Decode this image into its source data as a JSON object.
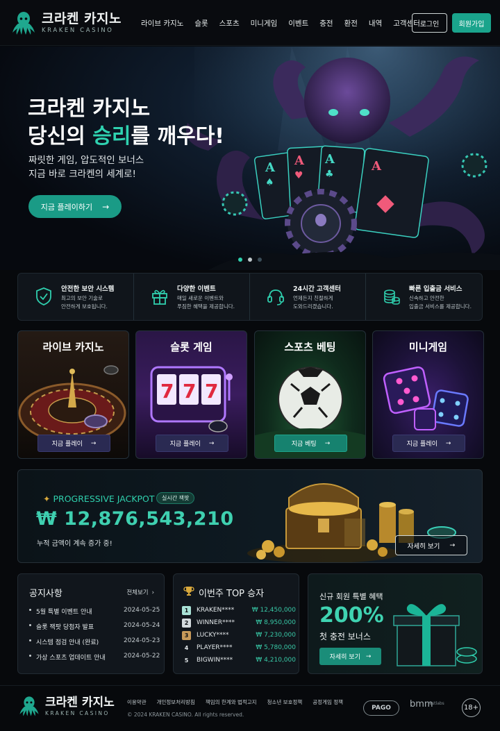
{
  "brand": {
    "name_ko": "크라켄 카지노",
    "name_en": "KRAKEN CASINO"
  },
  "nav": {
    "items": [
      "라이브 카지노",
      "슬롯",
      "스포츠",
      "미니게임",
      "이벤트",
      "충전",
      "환전",
      "내역",
      "고객센터"
    ],
    "login": "로그인",
    "join": "회원가입"
  },
  "hero": {
    "line1": "크라켄 카지노",
    "line2_pre": "당신의 ",
    "line2_accent": "승리",
    "line2_post": "를 깨우다!",
    "sub1": "짜릿한 게임, 압도적인 보너스",
    "sub2": "지금 바로 크라켄의 세계로!",
    "cta": "지금 플레이하기"
  },
  "features": [
    {
      "icon": "shield-check-icon",
      "title": "안전한 보안 시스템",
      "desc": "최고의 보안 기술로\n안전하게 보호됩니다."
    },
    {
      "icon": "gift-icon",
      "title": "다양한 이벤트",
      "desc": "매일 새로운 이벤트와\n푸짐한 혜택을 제공합니다."
    },
    {
      "icon": "headset-icon",
      "title": "24시간 고객센터",
      "desc": "언제든지 친절하게\n도와드리겠습니다."
    },
    {
      "icon": "coins-icon",
      "title": "빠른 입출금 서비스",
      "desc": "신속하고 안전한\n입출금 서비스를 제공합니다."
    }
  ],
  "games": [
    {
      "title": "라이브 카지노",
      "button": "지금 플레이"
    },
    {
      "title": "슬롯 게임",
      "button": "지금 플레이"
    },
    {
      "title": "스포츠 베팅",
      "button": "지금 베팅"
    },
    {
      "title": "미니게임",
      "button": "지금 플레이"
    }
  ],
  "jackpot": {
    "label": "PROGRESSIVE JACKPOT",
    "badge": "실시간 잭팟",
    "amount": "₩ 12,876,543,210",
    "sub": "누적 금액이 계속 증가 중!",
    "button": "자세히 보기"
  },
  "notice": {
    "title": "공지사항",
    "more": "전체보기",
    "items": [
      {
        "text": "5월 특별 이벤트 안내",
        "date": "2024-05-25"
      },
      {
        "text": "슬롯 잭팟 당첨자 발표",
        "date": "2024-05-24"
      },
      {
        "text": "시스템 점검 안내 (완료)",
        "date": "2024-05-23"
      },
      {
        "text": "가상 스포츠 업데이트 안내",
        "date": "2024-05-22"
      }
    ]
  },
  "winners": {
    "title": "이번주 TOP 승자",
    "items": [
      {
        "rank": "1",
        "name": "KRAKEN****",
        "amount": "₩ 12,450,000"
      },
      {
        "rank": "2",
        "name": "WINNER****",
        "amount": "₩ 8,950,000"
      },
      {
        "rank": "3",
        "name": "LUCKY****",
        "amount": "₩ 7,230,000"
      },
      {
        "rank": "4",
        "name": "PLAYER****",
        "amount": "₩ 5,780,000"
      },
      {
        "rank": "5",
        "name": "BIGWIN****",
        "amount": "₩ 4,210,000"
      }
    ]
  },
  "promo": {
    "title": "신규 회원 특별 혜택",
    "big": "200%",
    "sub": "첫 충전 보너스",
    "button": "자세히 보기"
  },
  "footer": {
    "links": [
      "이용약관",
      "개인정보처리방침",
      "책임의 한계와 법적고지",
      "청소년 보호정책",
      "공정게임 정책"
    ],
    "copyright": "© 2024 KRAKEN CASINO. All rights reserved.",
    "badge_pago": "PAGO",
    "badge_bmm": "bmm",
    "badge_bmm_sub": "testlabs",
    "age": "18+"
  },
  "colors": {
    "accent": "#1aa48c",
    "accent_text": "#2fd2b0",
    "bg": "#07090c"
  }
}
